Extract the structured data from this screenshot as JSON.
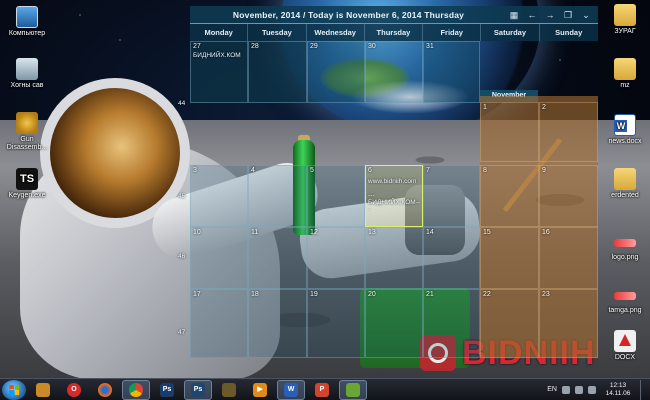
{
  "desktop": {
    "left_icons": [
      {
        "label": "Компьютер",
        "icon": "computer-icon"
      },
      {
        "label": "Хогны сав",
        "icon": "recycle-bin-icon"
      },
      {
        "label": "Gun Disassemb...",
        "icon": "gun-app-icon"
      },
      {
        "label": "Keygen.exe",
        "icon": "keygen-icon"
      }
    ],
    "right_icons": [
      {
        "label": "ЗУРАГ",
        "icon": "folder-icon"
      },
      {
        "label": "mz",
        "icon": "folder-icon"
      },
      {
        "label": "news.docx",
        "icon": "word-doc-icon"
      },
      {
        "label": "erdented",
        "icon": "folder-icon"
      },
      {
        "label": "logo.png",
        "icon": "png-image-icon"
      },
      {
        "label": "tamga.png",
        "icon": "png-image-icon"
      },
      {
        "label": "DOCX",
        "icon": "pdf-doc-icon"
      }
    ],
    "watermark_text": "BIDNIIH"
  },
  "calendar": {
    "title": "November, 2014 / Today is November 6, 2014 Thursday",
    "controls": [
      {
        "icon": "calendar-icon",
        "glyph": "▦"
      },
      {
        "icon": "arrow-left-icon",
        "glyph": "←"
      },
      {
        "icon": "arrow-right-icon",
        "glyph": "→"
      },
      {
        "icon": "window-icon",
        "glyph": "❐"
      },
      {
        "icon": "chevron-down-icon",
        "glyph": "⌄"
      }
    ],
    "weekdays": [
      "Monday",
      "Tuesday",
      "Wednesday",
      "Thursday",
      "Friday",
      "Saturday",
      "Sunday"
    ],
    "week_numbers": [
      "44",
      "45",
      "46",
      "47"
    ],
    "month_label": "November",
    "rows": [
      [
        "27",
        "28",
        "29",
        "30",
        "31",
        "",
        ""
      ],
      [
        "3",
        "4",
        "5",
        "6",
        "7",
        "8",
        "9"
      ],
      [
        "10",
        "11",
        "12",
        "13",
        "14",
        "15",
        "16"
      ],
      [
        "17",
        "18",
        "19",
        "20",
        "21",
        "22",
        "23"
      ]
    ],
    "month_top": [
      "1",
      "2"
    ],
    "notes": {
      "day27": "БИДНИЙХ.КОМ",
      "day6_line1": "www.bidniih.com",
      "day6_line2": "---БИДНИЙХ.КОМ---"
    }
  },
  "taskbar": {
    "apps": [
      {
        "icon": "explorer-icon",
        "label": "",
        "color": "#c98a2a"
      },
      {
        "icon": "opera-icon",
        "label": "O",
        "color": "#d62b2b"
      },
      {
        "icon": "firefox-icon",
        "label": "",
        "color": "#e86a1c"
      },
      {
        "icon": "chrome-icon",
        "label": "",
        "color": "#3ea545"
      },
      {
        "icon": "photoshop-icon",
        "label": "Ps",
        "color": "#1b3c68"
      },
      {
        "icon": "photoshop-cs-icon",
        "label": "Ps",
        "color": "#20466f"
      },
      {
        "icon": "game-icon",
        "label": "",
        "color": "#6a5a2a"
      },
      {
        "icon": "media-player-icon",
        "label": "▶",
        "color": "#e08a19"
      },
      {
        "icon": "word-icon",
        "label": "W",
        "color": "#2b5eb8"
      },
      {
        "icon": "powerpoint-icon",
        "label": "P",
        "color": "#d2442b"
      },
      {
        "icon": "desktop-calendar-icon",
        "label": "",
        "color": "#6aa636"
      }
    ],
    "language": "EN",
    "time": "12:13",
    "date": "14.11.06"
  }
}
